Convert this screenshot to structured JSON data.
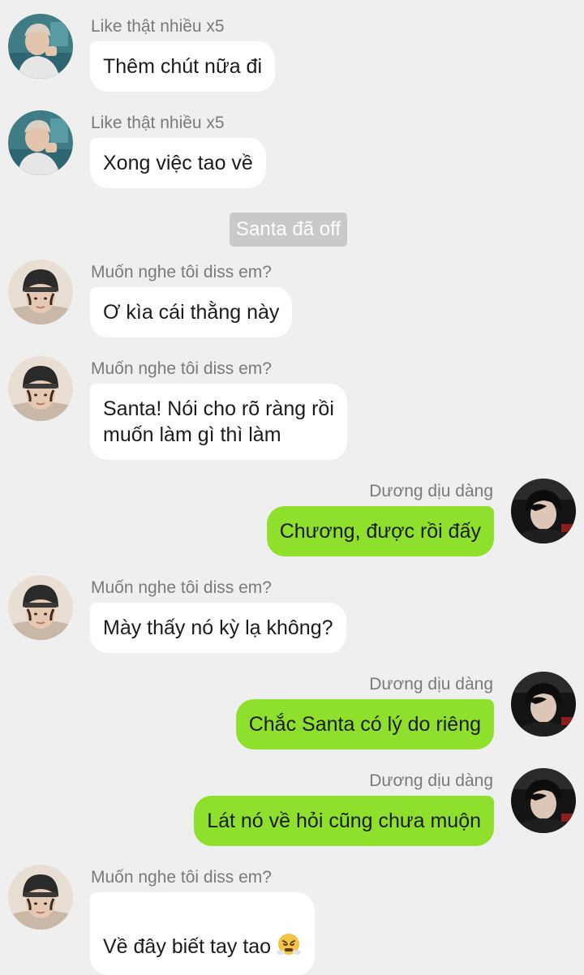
{
  "messages": [
    {
      "side": "left",
      "avatar": "avatar-santa",
      "name": "Like thật nhiều x5",
      "text": "Thêm chút nữa đi"
    },
    {
      "side": "left",
      "avatar": "avatar-santa",
      "name": "Like thật nhiều x5",
      "text": "Xong việc tao về"
    },
    {
      "side": "left",
      "avatar": "avatar-beanie",
      "name": "Muốn nghe tôi diss em?",
      "text": "Ơ kìa cái thằng này"
    },
    {
      "side": "left",
      "avatar": "avatar-beanie",
      "name": "Muốn nghe tôi diss em?",
      "text": "Santa! Nói cho rõ ràng rồi\nmuốn làm gì thì làm"
    },
    {
      "side": "right",
      "avatar": "avatar-duong",
      "name": "Dương dịu dàng",
      "text": "Chương, được rồi đấy"
    },
    {
      "side": "left",
      "avatar": "avatar-beanie",
      "name": "Muốn nghe tôi diss em?",
      "text": "Mày thấy nó kỳ lạ không?"
    },
    {
      "side": "right",
      "avatar": "avatar-duong",
      "name": "Dương dịu dàng",
      "text": "Chắc Santa có lý do riêng"
    },
    {
      "side": "right",
      "avatar": "avatar-duong",
      "name": "Dương dịu dàng",
      "text": "Lát nó về hỏi cũng chưa muộn"
    },
    {
      "side": "left",
      "avatar": "avatar-beanie",
      "name": "Muốn nghe tôi diss em?",
      "text": "Về đây biết tay tao",
      "emoji": "steam-from-nose-emoji"
    }
  ],
  "system_notice": "Santa đã off",
  "colors": {
    "background": "#efefef",
    "bubble_incoming": "#ffffff",
    "bubble_outgoing": "#8ee02c",
    "name_text": "#7a7a7a",
    "system_pill": "#c9c9c9"
  }
}
